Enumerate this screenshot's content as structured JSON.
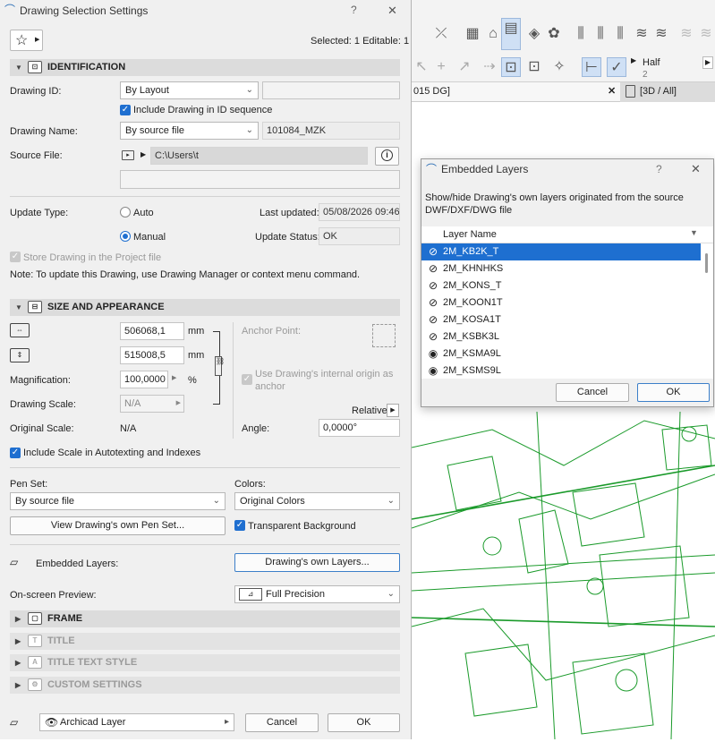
{
  "background_app": {
    "toolbar_half_label": "Half",
    "toolbar_half_value": "2",
    "tab_left": "015 DG]",
    "tab_right": "[3D / All]"
  },
  "dialog": {
    "title": "Drawing Selection Settings",
    "help": "?",
    "close": "✕",
    "selected_info": "Selected: 1 Editable: 1",
    "sections": {
      "identification": "IDENTIFICATION",
      "size": "SIZE AND APPEARANCE",
      "frame": "FRAME",
      "title": "TITLE",
      "title_text_style": "TITLE TEXT STYLE",
      "custom_settings": "CUSTOM SETTINGS"
    },
    "identification": {
      "drawing_id_label": "Drawing ID:",
      "drawing_id_value": "By Layout",
      "include_id_label": "Include Drawing in ID sequence",
      "drawing_name_label": "Drawing Name:",
      "drawing_name_mode": "By source file",
      "drawing_name_value": "101084_MZK",
      "source_file_label": "Source File:",
      "source_file_value": "C:\\Users\\t",
      "info_icon": "i",
      "update_type_label": "Update Type:",
      "auto_label": "Auto",
      "manual_label": "Manual",
      "last_updated_label": "Last updated:",
      "last_updated_value": "05/08/2026 09:46",
      "update_status_label": "Update Status:",
      "update_status_value": "OK",
      "store_label": "Store Drawing in the Project file",
      "note": "Note: To update this Drawing, use Drawing Manager or context menu command."
    },
    "size": {
      "width_value": "506068,1",
      "height_value": "515008,5",
      "unit_mm": "mm",
      "magnification_label": "Magnification:",
      "magnification_value": "100,0000",
      "percent": "%",
      "drawing_scale_label": "Drawing Scale:",
      "drawing_scale_value": "N/A",
      "original_scale_label": "Original Scale:",
      "original_scale_value": "N/A",
      "anchor_point_label": "Anchor Point:",
      "use_origin_label": "Use Drawing's internal origin as anchor",
      "relative_label": "Relative",
      "angle_label": "Angle:",
      "angle_value": "0,0000°",
      "include_scale_label": "Include Scale in Autotexting and Indexes",
      "pen_set_label": "Pen Set:",
      "pen_set_value": "By source file",
      "colors_label": "Colors:",
      "colors_value": "Original Colors",
      "view_pen_set_button": "View Drawing's own Pen Set...",
      "transparent_label": "Transparent Background",
      "embedded_layers_label": "Embedded Layers:",
      "own_layers_button": "Drawing's own Layers...",
      "preview_label": "On-screen Preview:",
      "preview_value": "Full Precision"
    },
    "footer": {
      "layer_value": "Archicad Layer",
      "cancel": "Cancel",
      "ok": "OK"
    }
  },
  "embedded_layers": {
    "title": "Embedded Layers",
    "help": "?",
    "close": "✕",
    "description": "Show/hide Drawing's own layers originated from the source DWF/DXF/DWG file",
    "column_header": "Layer Name",
    "layers": [
      {
        "name": "2M_KB2K_T",
        "visible": false,
        "selected": true
      },
      {
        "name": "2M_KHNHKS",
        "visible": false,
        "selected": false
      },
      {
        "name": "2M_KONS_T",
        "visible": false,
        "selected": false
      },
      {
        "name": "2M_KOON1T",
        "visible": false,
        "selected": false
      },
      {
        "name": "2M_KOSA1T",
        "visible": false,
        "selected": false
      },
      {
        "name": "2M_KSBK3L",
        "visible": false,
        "selected": false
      },
      {
        "name": "2M_KSMA9L",
        "visible": true,
        "selected": false
      },
      {
        "name": "2M_KSMS9L",
        "visible": true,
        "selected": false
      }
    ],
    "cancel": "Cancel",
    "ok": "OK"
  }
}
